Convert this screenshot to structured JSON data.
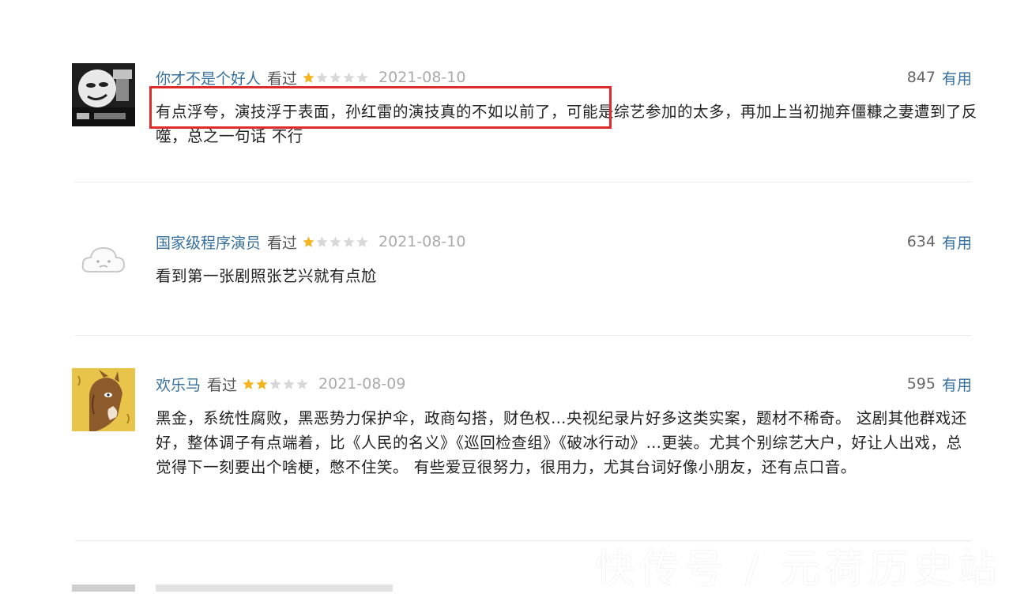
{
  "reviews": [
    {
      "author": "你才不是个好人",
      "status": "看过",
      "rating": 1,
      "date": "2021-08-10",
      "votes": "847",
      "useful_label": "有用",
      "avatar_icon": "meme-face-avatar",
      "content": "有点浮夸，演技浮于表面，孙红雷的演技真的不如以前了，可能是综艺参加的太多，再加上当初抛弃僵糠之妻遭到了反噬，总之一句话 不行"
    },
    {
      "author": "国家级程序演员",
      "status": "看过",
      "rating": 1,
      "date": "2021-08-10",
      "votes": "634",
      "useful_label": "有用",
      "avatar_icon": "default-cloud-avatar",
      "content": "看到第一张剧照张艺兴就有点尬"
    },
    {
      "author": "欢乐马",
      "status": "看过",
      "rating": 2,
      "date": "2021-08-09",
      "votes": "595",
      "useful_label": "有用",
      "avatar_icon": "horse-avatar",
      "content": "黑金，系统性腐败，黑恶势力保护伞，政商勾搭，财色权…央视纪录片好多这类实案，题材不稀奇。 这剧其他群戏还好，整体调子有点端着，比《人民的名义》《巡回检查组》《破冰行动》…更装。尤其个别综艺大户，好让人出戏，总觉得下一刻要出个啥梗，憋不住笑。 有些爱豆很努力，很用力，尤其台词好像小朋友，还有点口音。"
    }
  ],
  "watermark": "快传号 / 元荷历史站",
  "colors": {
    "link": "#37709d",
    "star_on": "#f5b41f",
    "star_off": "#d8d8d8",
    "highlight": "#e02b2b"
  }
}
